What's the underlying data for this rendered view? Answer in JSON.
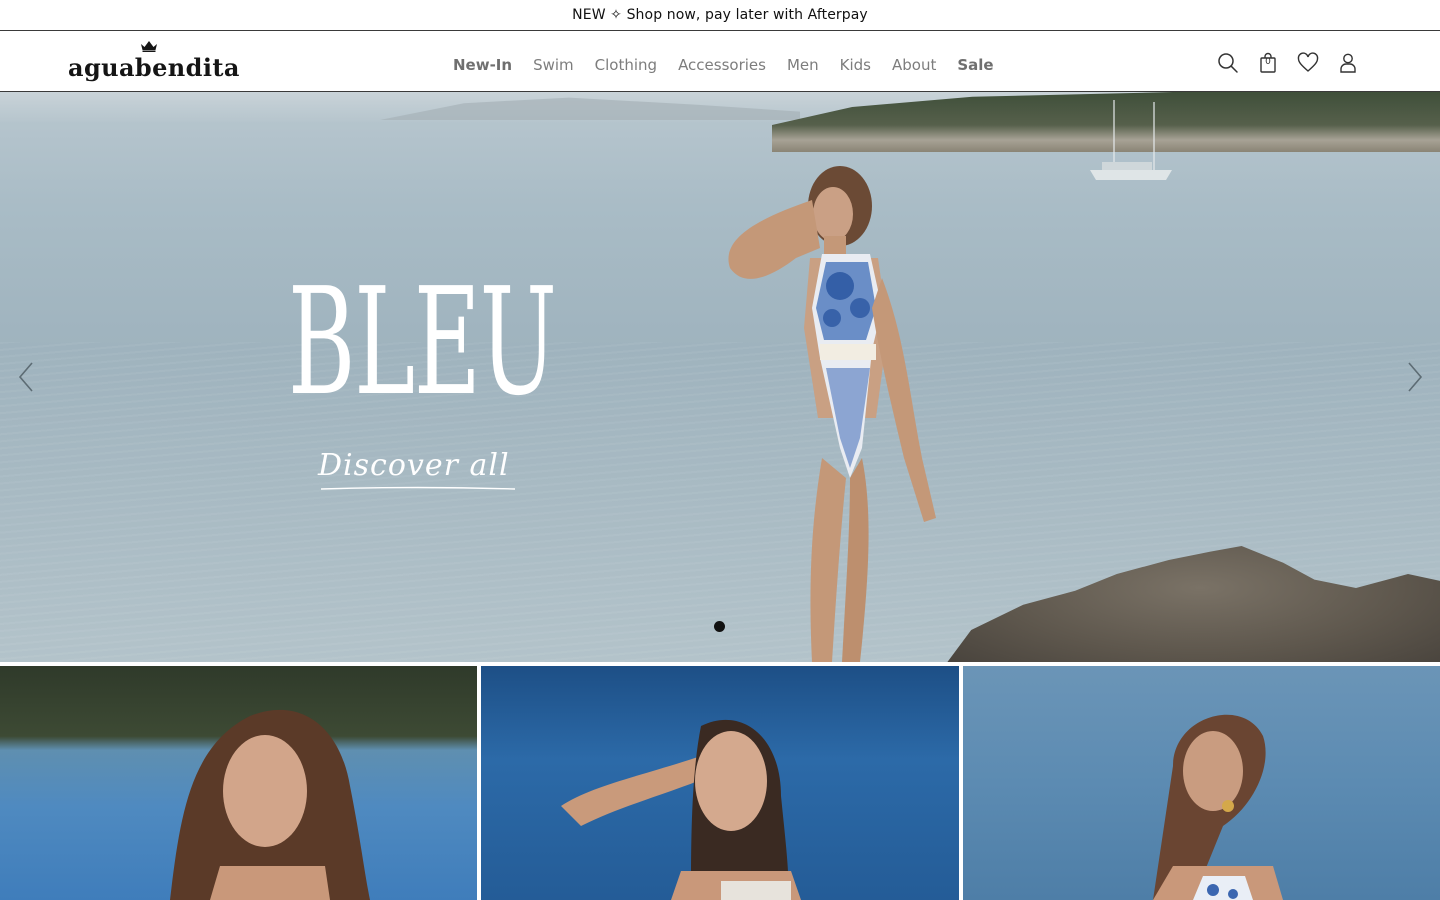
{
  "announcement": {
    "text": "NEW ✧ Shop now, pay later with Afterpay"
  },
  "header": {
    "logo_text": "aguabendita",
    "nav": [
      {
        "label": "New-In",
        "bold": true
      },
      {
        "label": "Swim",
        "bold": false
      },
      {
        "label": "Clothing",
        "bold": false
      },
      {
        "label": "Accessories",
        "bold": false
      },
      {
        "label": "Men",
        "bold": false
      },
      {
        "label": "Kids",
        "bold": false
      },
      {
        "label": "About",
        "bold": false
      },
      {
        "label": "Sale",
        "bold": true
      }
    ],
    "icons": [
      "search-icon",
      "bag-icon",
      "heart-icon",
      "user-icon"
    ],
    "bag_count": "0"
  },
  "hero": {
    "title": "BLEU",
    "cta": "Discover all",
    "slides_total": 1,
    "active_slide": 1,
    "prev_icon": "chevron-left-icon",
    "next_icon": "chevron-right-icon"
  },
  "colors": {
    "border": "#3a3a3a",
    "nav_text": "#7d7d7d",
    "hero_text": "#ffffff",
    "dot": "#111111"
  },
  "tiles": [
    {
      "name": "product-tile-1"
    },
    {
      "name": "product-tile-2"
    },
    {
      "name": "product-tile-3"
    }
  ]
}
